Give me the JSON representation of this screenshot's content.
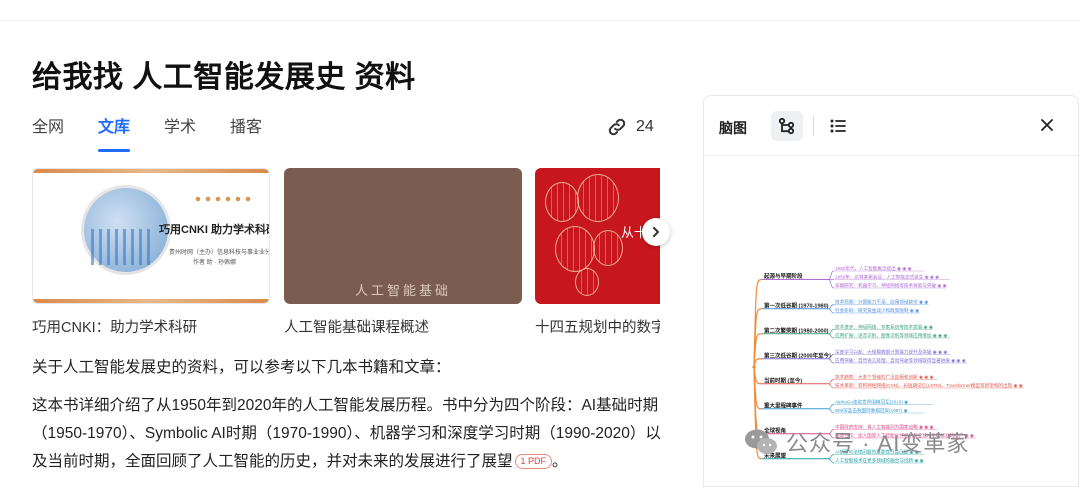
{
  "query_title": "给我找 人工智能发展史 资料",
  "tabs": [
    {
      "label": "全网",
      "active": false
    },
    {
      "label": "文库",
      "active": true
    },
    {
      "label": "学术",
      "active": false
    },
    {
      "label": "播客",
      "active": false
    }
  ],
  "source_count": "24",
  "cards": [
    {
      "caption": "巧用CNKI：助力学术科研",
      "thumb_title": "巧用CNKI  助力学术科研",
      "thumb_sub1": "贵州时网（主办）信息科技与事业业分公司",
      "thumb_sub2": "作者 助 · 孙佩娜"
    },
    {
      "caption": "人工智能基础课程概述",
      "thumb_title": "人工智能基础"
    },
    {
      "caption": "十四五规划中的数字化",
      "thumb_title": "从十"
    }
  ],
  "answer": {
    "intro": "关于人工智能发展史的资料，可以参考以下几本书籍和文章：",
    "paragraph": "这本书详细介绍了从1950年到2020年的人工智能发展历程。书中分为四个阶段：AI基础时期（1950-1970）、Symbolic AI时期（1970-1990）、机器学习和深度学习时期（1990-2020）以及当前时期，全面回顾了人工智能的历史，并对未来的发展进行了展望",
    "citation": "1 PDF",
    "tail": "。"
  },
  "panel": {
    "title": "脑图",
    "mindmap": {
      "branches": [
        {
          "label": "起源与早期阶段",
          "color": "#b06ad4",
          "leaves": [
            "1950年代，人工智能概念提出 ◉ ◉ ◉",
            "1956年，达特茅斯会议，人工智能正式诞生 ◉ ◉ ◉",
            "早期研究：机器学习、神经网络等技术探索与突破 ◉ ◉"
          ]
        },
        {
          "label": "第一次低谷期 (1970-1980)",
          "color": "#4f8fe0",
          "leaves": [
            "技术局限：计算能力不足、应用领域狭窄 ◉ ◉",
            "社会影响：研究资金减少和政策限制 ◉ ◉"
          ]
        },
        {
          "label": "第二次繁荣期 (1980-2000)",
          "color": "#3aa37a",
          "leaves": [
            "技术进步：神经网络、专家系统等技术发展 ◉ ◉",
            "应用扩展：语音识别、图像识别等领域应用增加 ◉ ◉ ◉"
          ]
        },
        {
          "label": "第三次低谷期 (2000年至今)",
          "color": "#7a6fd6",
          "leaves": [
            "深度学习兴起：大规模数据计算能力提升及突破 ◉ ◉ ◉",
            "应用突破：自然语言处理、自动驾驶等领域取得显著进展 ◉ ◉ ◉"
          ]
        },
        {
          "label": "当前时期 (至今)",
          "color": "#e05a4f",
          "leaves": [
            "技术趋势：大多个领域的广泛应用和创新 ◉ ◉ ◉",
            "技术革新：卷积神经网络(CNN)、长短期记忆(LSTM)、Transformer模型等新架构的出现 ◉ ◉"
          ]
        },
        {
          "label": "重大里程碑事件",
          "color": "#3a9bd4",
          "leaves": [
            "AlphaGo击败世界围棋冠军(2016) ◉",
            "IBM深蓝击败国际象棋冠军(1997) ◉"
          ]
        },
        {
          "label": "全球视角",
          "color": "#d9488b",
          "leaves": [
            "中国政府支持：将人工智能列为国家战略 ◉ ◉ ◉",
            "国际合作：加入国际人工智能伙伴组织及全球AI伦理标准的推广 ◉ ◉"
          ]
        },
        {
          "label": "未来展望",
          "color": "#22a0a8",
          "leaves": [
            "AI伦理与法律问题的重要性日益凸显 ◉ ◉",
            "人工智能技术在更多领域的融合与创新 ◉ ◉"
          ]
        }
      ]
    }
  },
  "watermark": "公众号 · AI变革家",
  "colors": {
    "accent": "#1f6bff",
    "pdf_red": "#e0453a",
    "mindmap_root": "#f28a3a"
  }
}
